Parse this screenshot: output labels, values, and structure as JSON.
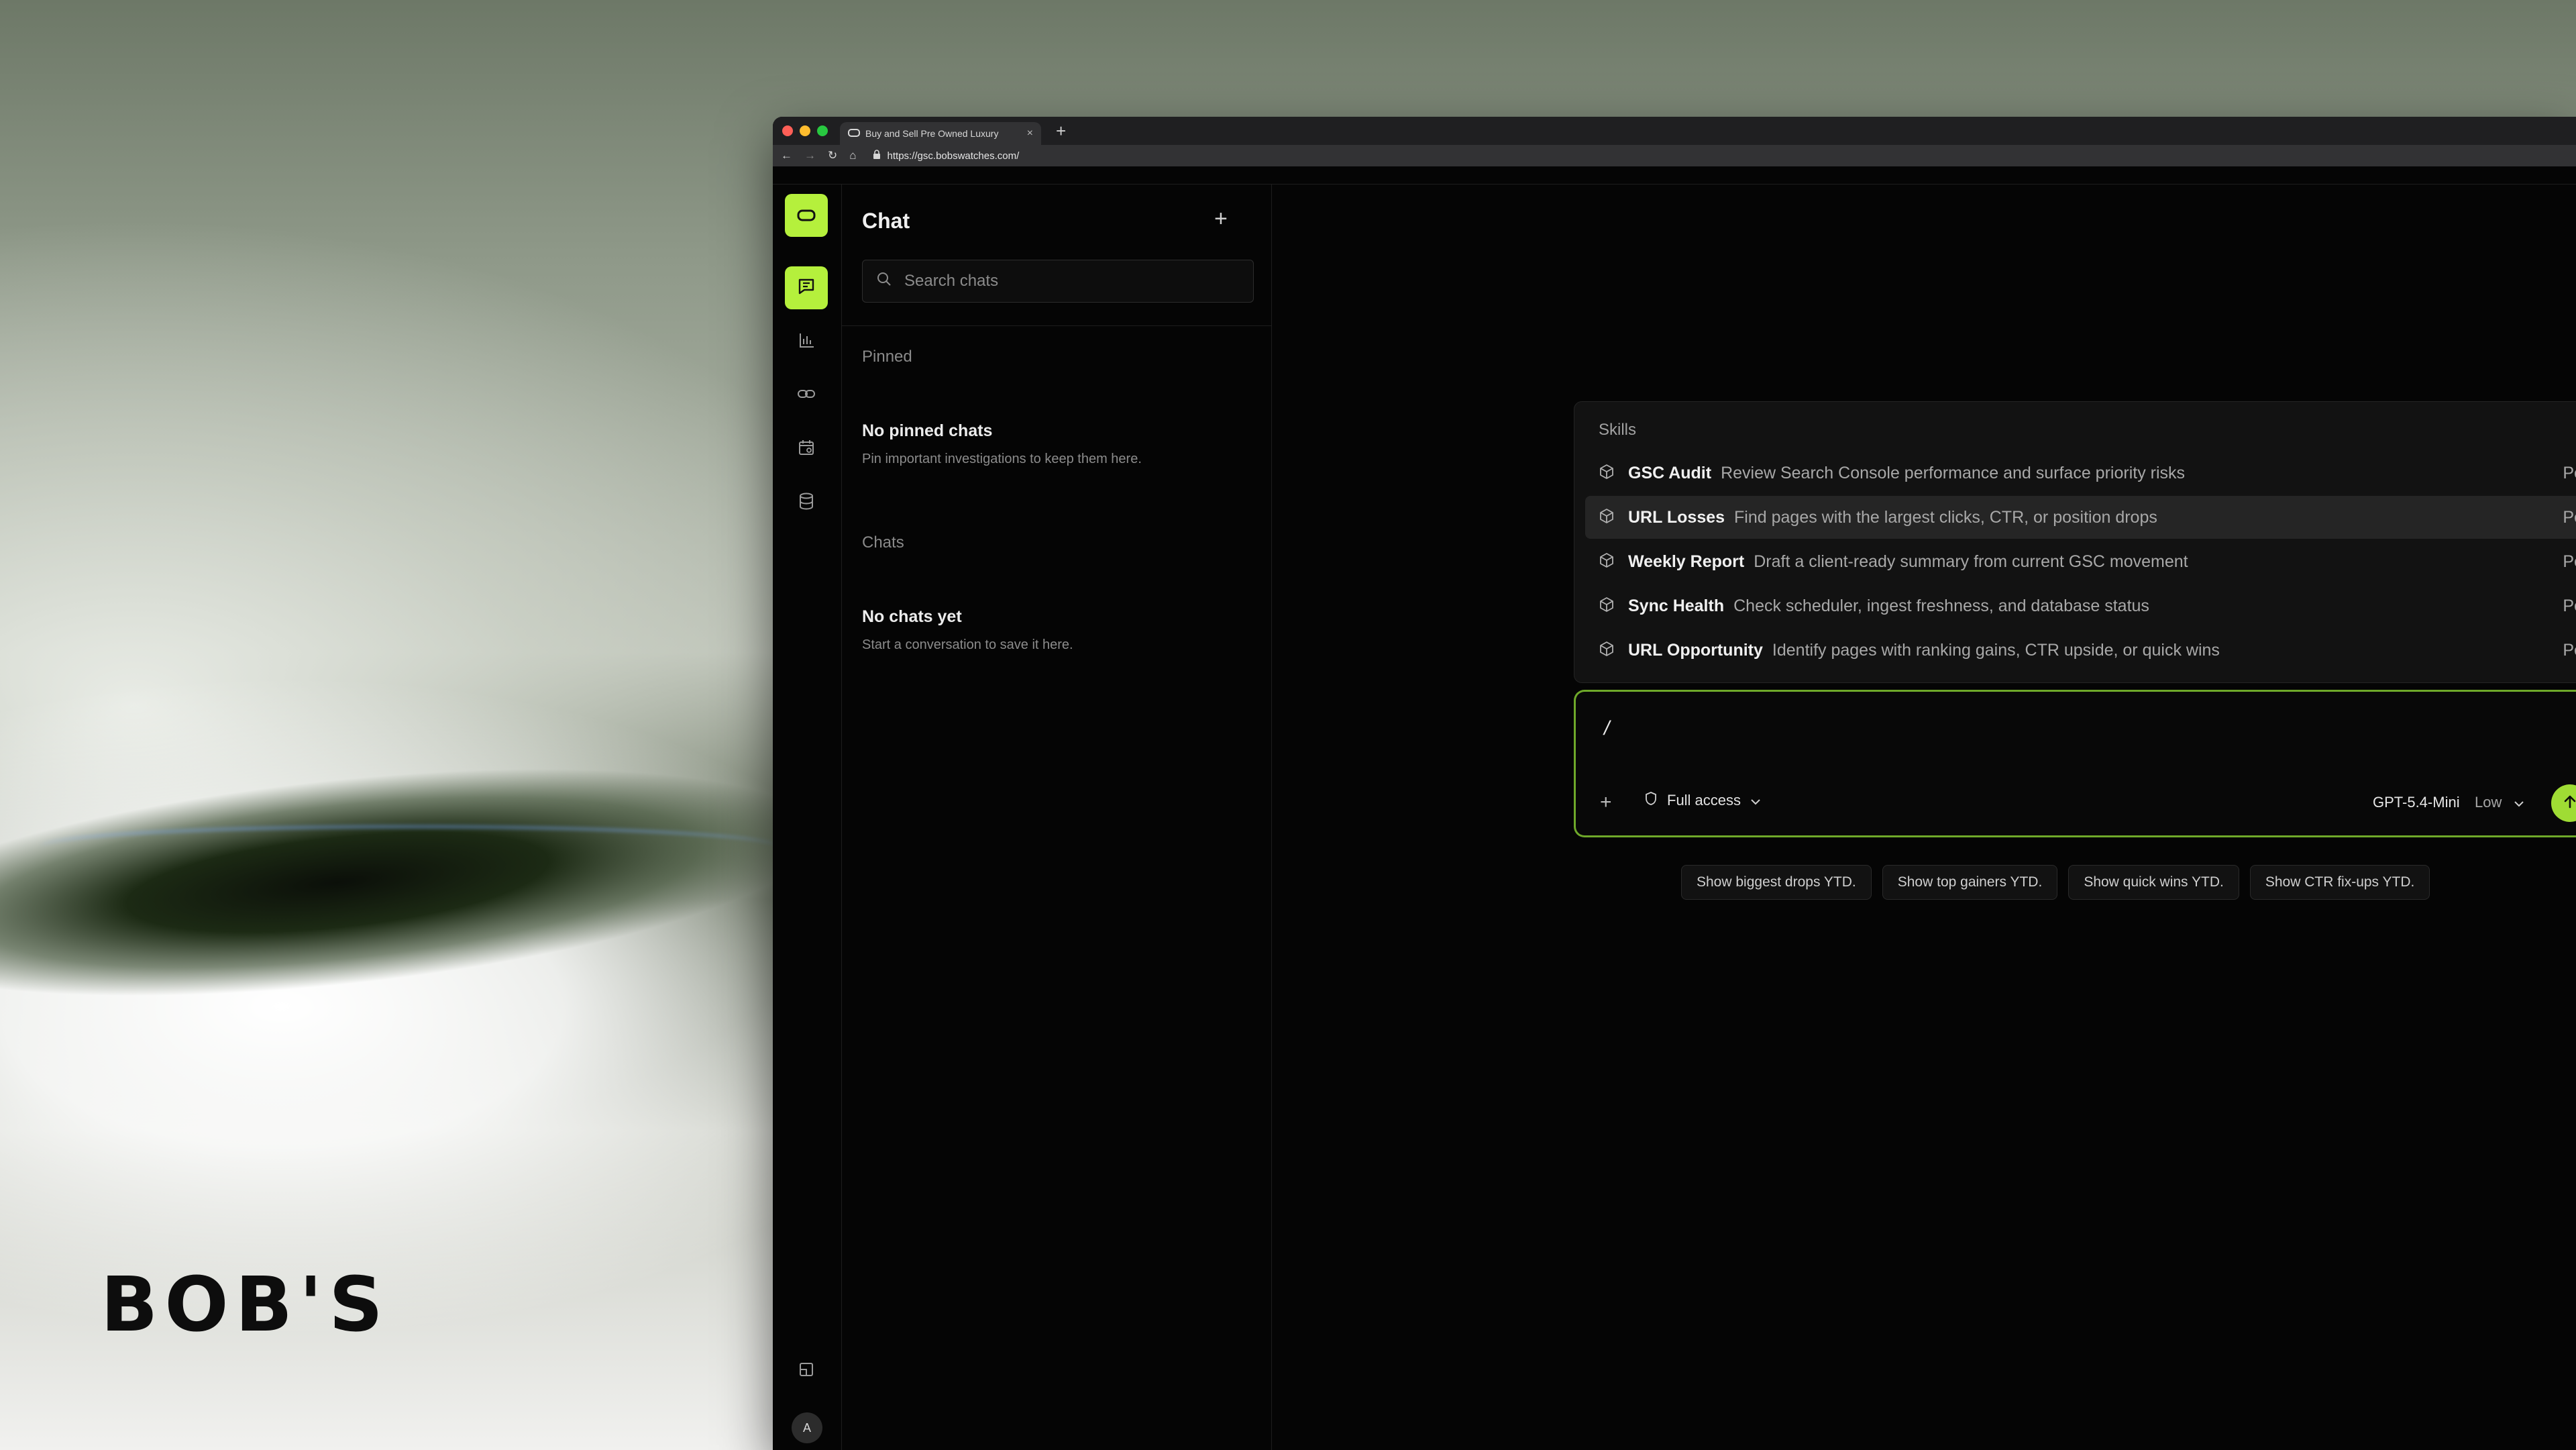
{
  "background": {
    "brand_logo": "BOB'S"
  },
  "browser": {
    "tab_title": "Buy and Sell Pre Owned Luxury",
    "tab_close": "×",
    "new_tab": "+",
    "url": "https://gsc.bobswatches.com/",
    "traffic_colors": [
      "#ff5f57",
      "#febc2e",
      "#28c840"
    ]
  },
  "rail": {
    "items": [
      "chat-icon",
      "chart-icon",
      "link-icon",
      "calendar-icon",
      "database-icon"
    ],
    "avatar": "A",
    "accent": "#b5f03c"
  },
  "sidebar": {
    "title": "Chat",
    "new_chat": "+",
    "search_placeholder": "Search chats",
    "pinned_label": "Pinned",
    "pinned_empty_title": "No pinned chats",
    "pinned_empty_sub": "Pin important investigations to keep them here.",
    "chats_label": "Chats",
    "chats_empty_title": "No chats yet",
    "chats_empty_sub": "Start a conversation to save it here."
  },
  "skills": {
    "heading": "Skills",
    "items": [
      {
        "name": "GSC Audit",
        "desc": "Review Search Console performance and surface priority risks",
        "tag": "Personal"
      },
      {
        "name": "URL Losses",
        "desc": "Find pages with the largest clicks, CTR, or position drops",
        "tag": "Personal"
      },
      {
        "name": "Weekly Report",
        "desc": "Draft a client-ready summary from current GSC movement",
        "tag": "Personal"
      },
      {
        "name": "Sync Health",
        "desc": "Check scheduler, ingest freshness, and database status",
        "tag": "Personal"
      },
      {
        "name": "URL Opportunity",
        "desc": "Identify pages with ranking gains, CTR upside, or quick wins",
        "tag": "Personal"
      }
    ]
  },
  "composer": {
    "input_value": "/",
    "access_label": "Full access",
    "model": "GPT-5.4-Mini",
    "effort": "Low",
    "accent": "#9fdc34"
  },
  "suggestions": [
    "Show biggest drops YTD.",
    "Show top gainers YTD.",
    "Show quick wins YTD.",
    "Show CTR fix-ups YTD."
  ]
}
